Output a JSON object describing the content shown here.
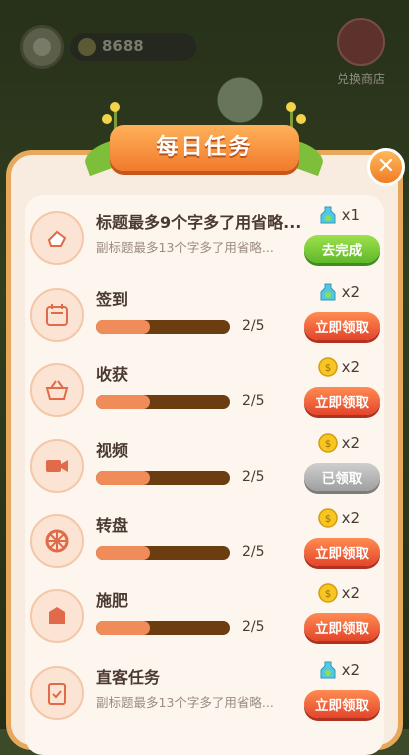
{
  "hud": {
    "coin_count": "8688",
    "shop_label": "兑换商店"
  },
  "panel": {
    "title": "每日任务",
    "close_glyph": "✕"
  },
  "tasks": [
    {
      "title": "标题最多9个字多了用省略...",
      "subtitle": "副标题最多13个字多了用省略...",
      "reward_icon": "bottle-icon",
      "reward_count": "x1",
      "button": "去完成",
      "button_style": "green",
      "icon": "hand-icon"
    },
    {
      "title": "签到",
      "progress_text": "2/5",
      "progress": 0.4,
      "reward_icon": "bottle-icon",
      "reward_count": "x2",
      "button": "立即领取",
      "button_style": "red",
      "icon": "calendar-icon"
    },
    {
      "title": "收获",
      "progress_text": "2/5",
      "progress": 0.4,
      "reward_icon": "coin-icon",
      "reward_count": "x2",
      "button": "立即领取",
      "button_style": "red",
      "icon": "basket-icon"
    },
    {
      "title": "视频",
      "progress_text": "2/5",
      "progress": 0.4,
      "reward_icon": "coin-icon",
      "reward_count": "x2",
      "button": "已领取",
      "button_style": "gray",
      "icon": "video-icon"
    },
    {
      "title": "转盘",
      "progress_text": "2/5",
      "progress": 0.4,
      "reward_icon": "coin-icon",
      "reward_count": "x2",
      "button": "立即领取",
      "button_style": "red",
      "icon": "wheel-icon"
    },
    {
      "title": "施肥",
      "progress_text": "2/5",
      "progress": 0.4,
      "reward_icon": "coin-icon",
      "reward_count": "x2",
      "button": "立即领取",
      "button_style": "red",
      "icon": "fertilizer-icon"
    },
    {
      "title": "直客任务",
      "subtitle": "副标题最多13个字多了用省略...",
      "reward_icon": "bottle-icon",
      "reward_count": "x2",
      "button": "立即领取",
      "button_style": "red",
      "icon": "clipboard-icon"
    }
  ]
}
